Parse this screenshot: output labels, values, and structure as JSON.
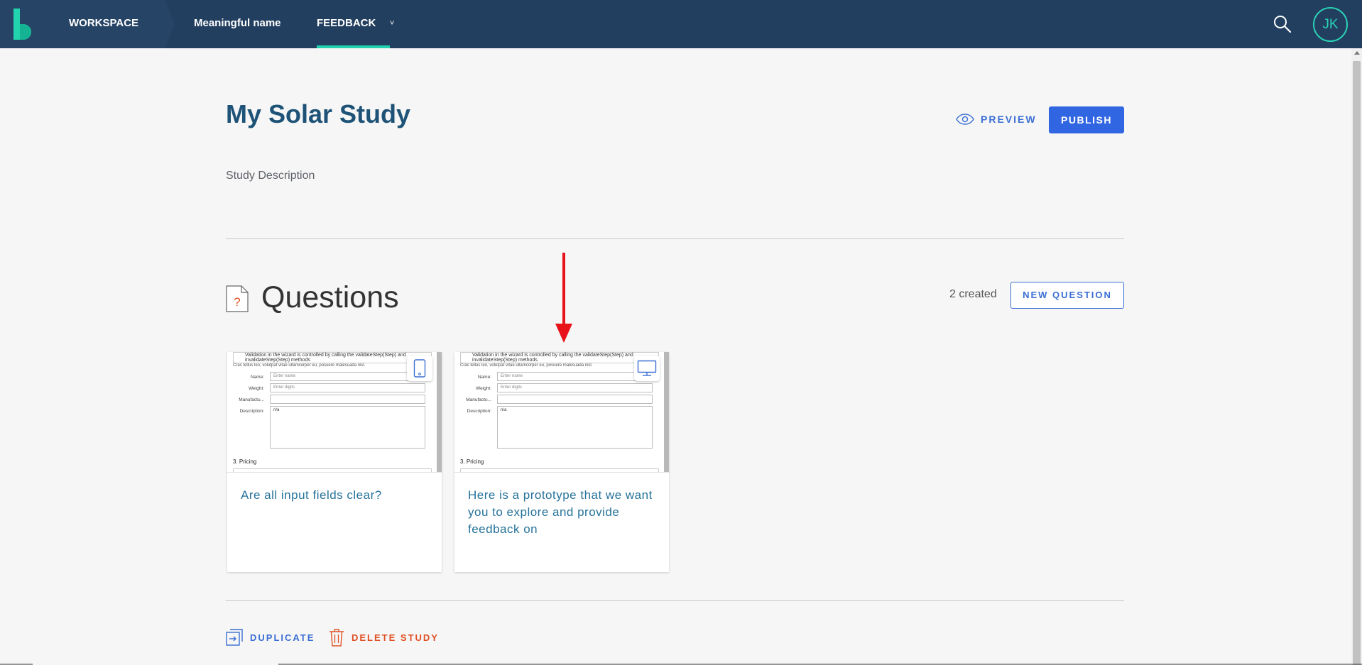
{
  "nav": {
    "workspace": "WORKSPACE",
    "project": "Meaningful name",
    "feedback": "FEEDBACK",
    "feedback_chevron": "˅",
    "avatar_initials": "JK",
    "icons": {
      "logo": "logo-icon",
      "search": "search-icon",
      "chevron": "chevron-down-icon"
    },
    "colors": {
      "bar": "#233f60",
      "accent": "#22d3b0"
    }
  },
  "study": {
    "title": "My Solar Study",
    "description": "Study Description",
    "preview_label": "PREVIEW",
    "publish_label": "PUBLISH"
  },
  "questions": {
    "heading": "Questions",
    "count_text": "2 created",
    "new_label": "NEW QUESTION",
    "cards": [
      {
        "device": "tablet-icon",
        "text": "Are all input fields clear?",
        "thumb": {
          "note": "Validation in the wizard is controlled by calling the validateStep(Step) and invalidateStep(Step) methods",
          "lorem": "Cras tellus leo, volutpat vitae ullamcorper eu, posuere malesuada nisl.",
          "name_label": "Name:",
          "name_placeholder": "Enter name",
          "weight_label": "Weight:",
          "weight_placeholder": "Enter digits",
          "manuf_label": "Manufactu...",
          "desc_label": "Description:",
          "desc_value": "n/a",
          "section": "3. Pricing"
        }
      },
      {
        "device": "desktop-icon",
        "text": "Here is a prototype that we want you to explore and provide feedback on",
        "thumb": {
          "note": "Validation in the wizard is controlled by calling the validateStep(Step) and invalidateStep(Step) methods",
          "lorem": "Cras tellus leo, volutpat vitae ullamcorper eu, posuere malesuada nisl.",
          "name_label": "Name:",
          "name_placeholder": "Enter name",
          "weight_label": "Weight:",
          "weight_placeholder": "Enter digits",
          "manuf_label": "Manufactu...",
          "desc_label": "Description:",
          "desc_value": "n/a",
          "section": "3. Pricing"
        }
      }
    ]
  },
  "footer": {
    "duplicate_label": "DUPLICATE",
    "delete_label": "DELETE STUDY"
  },
  "annotation": {
    "icon": "red-arrow-down-icon",
    "color": "#e8121a"
  }
}
